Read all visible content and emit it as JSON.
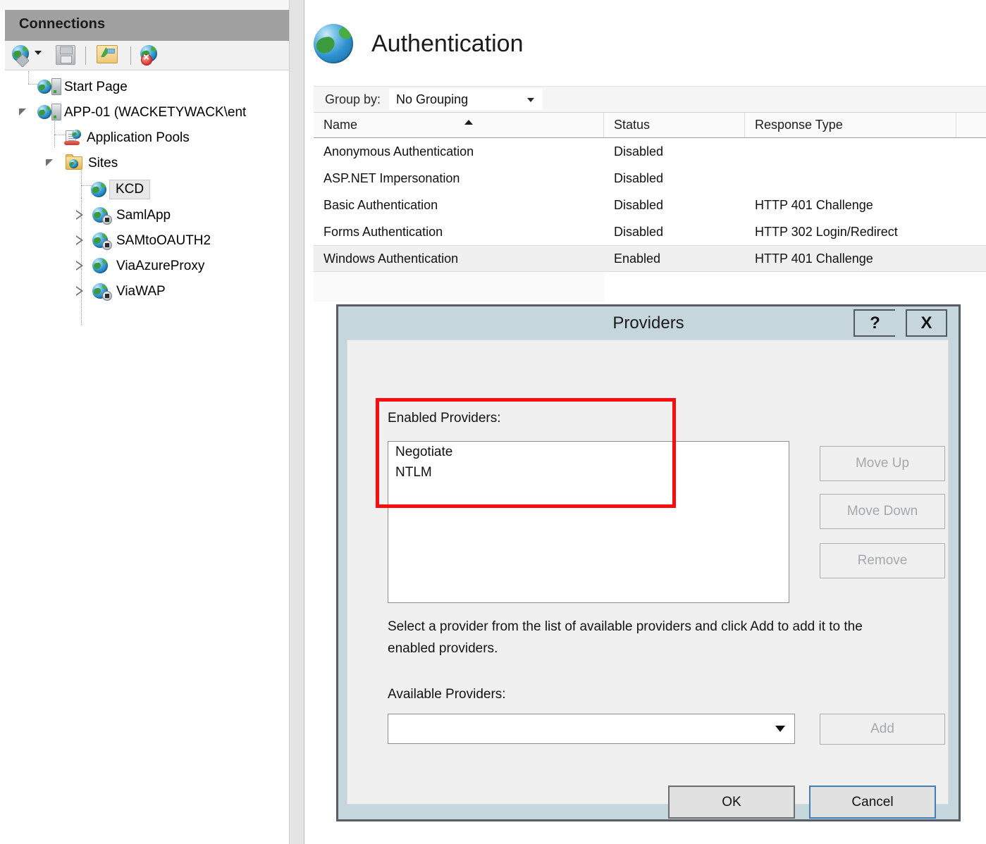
{
  "connections": {
    "header_title": "Connections",
    "toolbar": [
      {
        "name": "connect-to-icon",
        "label": "Connect to"
      },
      {
        "name": "save-connections-icon",
        "label": "Save Connections"
      },
      {
        "name": "connect-to-site-icon",
        "label": "Connect to a Site"
      },
      {
        "name": "disconnect-icon",
        "label": "Disconnect"
      }
    ],
    "tree": [
      {
        "label": "Start Page",
        "icon": "server-globe-icon",
        "expander": "none",
        "indent": 0,
        "selected": false
      },
      {
        "label": "APP-01 (WACKETYWACK\\ent",
        "icon": "server-globe-icon",
        "expander": "expanded",
        "indent": 0,
        "selected": false
      },
      {
        "label": "Application Pools",
        "icon": "application-pools-icon",
        "expander": "none",
        "indent": 1,
        "selected": false
      },
      {
        "label": "Sites",
        "icon": "sites-folder-icon",
        "expander": "expanded",
        "indent": 1,
        "selected": false
      },
      {
        "label": "KCD",
        "icon": "site-globe-icon",
        "expander": "none",
        "indent": 2,
        "selected": true
      },
      {
        "label": "SamlApp",
        "icon": "site-globe-stopped-icon",
        "expander": "collapsed",
        "indent": 2,
        "selected": false
      },
      {
        "label": "SAMtoOAUTH2",
        "icon": "site-globe-stopped-icon",
        "expander": "collapsed",
        "indent": 2,
        "selected": false
      },
      {
        "label": "ViaAzureProxy",
        "icon": "site-globe-icon",
        "expander": "collapsed",
        "indent": 2,
        "selected": false
      },
      {
        "label": "ViaWAP",
        "icon": "site-globe-stopped-icon",
        "expander": "collapsed",
        "indent": 2,
        "selected": false
      }
    ]
  },
  "authentication": {
    "page_title": "Authentication",
    "page_icon": "globe-icon",
    "group_by_label": "Group by:",
    "group_by_value": "No Grouping",
    "columns": [
      "Name",
      "Status",
      "Response Type"
    ],
    "sort_column": "Name",
    "sort_direction": "ascending",
    "rows": [
      {
        "name": "Anonymous Authentication",
        "status": "Disabled",
        "response_type": "",
        "selected": false
      },
      {
        "name": "ASP.NET Impersonation",
        "status": "Disabled",
        "response_type": "",
        "selected": false
      },
      {
        "name": "Basic Authentication",
        "status": "Disabled",
        "response_type": "HTTP 401 Challenge",
        "selected": false
      },
      {
        "name": "Forms Authentication",
        "status": "Disabled",
        "response_type": "HTTP 302 Login/Redirect",
        "selected": false
      },
      {
        "name": "Windows Authentication",
        "status": "Enabled",
        "response_type": "HTTP 401 Challenge",
        "selected": true
      }
    ]
  },
  "providers_dialog": {
    "title": "Providers",
    "help_button": "?",
    "close_button": "X",
    "enabled_providers_label": "Enabled Providers:",
    "enabled_providers": [
      "Negotiate",
      "NTLM"
    ],
    "move_up_label": "Move Up",
    "move_down_label": "Move Down",
    "remove_label": "Remove",
    "hint_text": "Select a provider from the list of available providers and click Add to add it to the enabled providers.",
    "available_providers_label": "Available Providers:",
    "available_providers_value": "",
    "add_label": "Add",
    "ok_label": "OK",
    "cancel_label": "Cancel",
    "highlight_color": "#fb0d0d",
    "titlebar_color": "#c5d6dc"
  }
}
